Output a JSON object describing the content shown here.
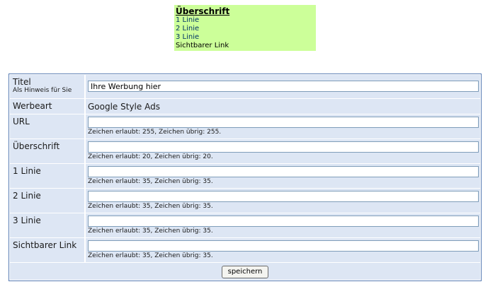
{
  "preview": {
    "title": "Überschrift",
    "line1": "1 Linie",
    "line2": "2 Linie",
    "line3": "3 Linie",
    "visible_link": "Sichtbarer Link"
  },
  "form": {
    "titel": {
      "label": "Titel",
      "hint": "Als Hinweis für Sie",
      "value": "Ihre Werbung hier"
    },
    "werbeart": {
      "label": "Werbeart",
      "value": "Google Style Ads"
    },
    "url": {
      "label": "URL",
      "value": "",
      "counter": "Zeichen erlaubt: 255, Zeichen übrig: 255."
    },
    "ueberschrift": {
      "label": "Überschrift",
      "value": "",
      "counter": "Zeichen erlaubt: 20, Zeichen übrig: 20."
    },
    "linie1": {
      "label": "1 Linie",
      "value": "",
      "counter": "Zeichen erlaubt: 35, Zeichen übrig: 35."
    },
    "linie2": {
      "label": "2 Linie",
      "value": "",
      "counter": "Zeichen erlaubt: 35, Zeichen übrig: 35."
    },
    "linie3": {
      "label": "3 Linie",
      "value": "",
      "counter": "Zeichen erlaubt: 35, Zeichen übrig: 35."
    },
    "link": {
      "label": "Sichtbarer Link",
      "value": "",
      "counter": "Zeichen erlaubt: 35, Zeichen übrig: 35."
    },
    "save_label": "speichern"
  },
  "colors": {
    "preview_bg": "#ccff99",
    "row_bg": "#dde6f4",
    "border": "#5a7db4"
  }
}
